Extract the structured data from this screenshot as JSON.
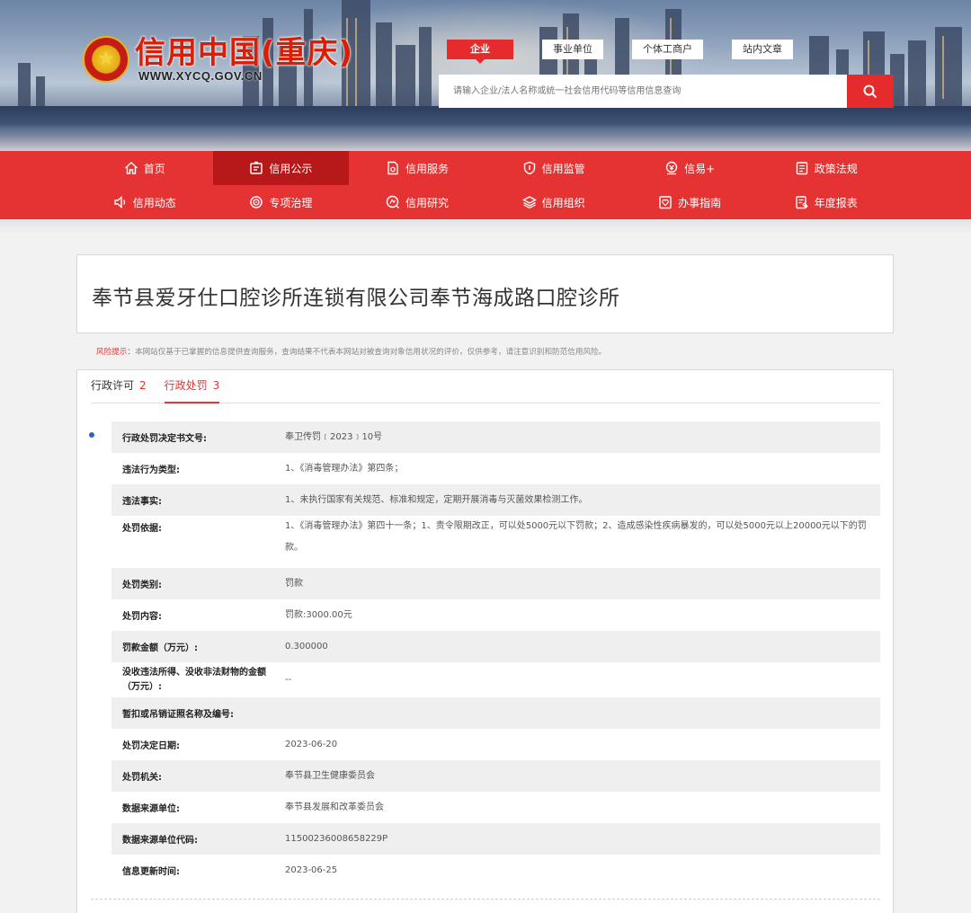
{
  "header": {
    "logo_title": "信用中国(重庆)",
    "logo_url": "WWW.XYCQ.GOV.CN",
    "search_tabs": [
      "企业",
      "事业单位",
      "个体工商户",
      "站内文章"
    ],
    "search_placeholder": "请输入企业/法人名称或统一社会信用代码等信用信息查询"
  },
  "nav": {
    "row1": [
      {
        "label": "首页",
        "icon": "home-icon"
      },
      {
        "label": "信用公示",
        "icon": "notice-icon",
        "active": true
      },
      {
        "label": "信用服务",
        "icon": "document-icon"
      },
      {
        "label": "信用监管",
        "icon": "shield-icon"
      },
      {
        "label": "信易+",
        "icon": "coin-icon"
      },
      {
        "label": "政策法规",
        "icon": "law-icon"
      }
    ],
    "row2": [
      {
        "label": "信用动态",
        "icon": "speaker-icon"
      },
      {
        "label": "专项治理",
        "icon": "target-icon"
      },
      {
        "label": "信用研究",
        "icon": "research-icon"
      },
      {
        "label": "信用组织",
        "icon": "layers-icon"
      },
      {
        "label": "办事指南",
        "icon": "guide-icon"
      },
      {
        "label": "年度报表",
        "icon": "report-icon"
      }
    ]
  },
  "company_name": "奉节县爱牙仕口腔诊所连锁有限公司奉节海成路口腔诊所",
  "risk": {
    "label": "风险提示：",
    "text": "本网站仅基于已掌握的信息提供查询服务，查询结果不代表本网站对被查询对象信用状况的评价，仅供参考，请注意识别和防范信用风险。"
  },
  "tabs": [
    {
      "label": "行政许可",
      "count": "2"
    },
    {
      "label": "行政处罚",
      "count": "3",
      "active": true
    }
  ],
  "details": [
    {
      "key": "行政处罚决定书文号:",
      "value": "奉卫传罚﹝2023﹞10号"
    },
    {
      "key": "违法行为类型:",
      "value": "1、《消毒管理办法》第四条；"
    },
    {
      "key": "违法事实:",
      "value": "1、未执行国家有关规范、标准和规定，定期开展消毒与灭菌效果检测工作。"
    },
    {
      "key": "处罚依据:",
      "value": "1、《消毒管理办法》第四十一条；1、责令限期改正，可以处5000元以下罚款；2、造成感染性疾病暴发的，可以处5000元以上20000元以下的罚款。"
    },
    {
      "key": "处罚类别:",
      "value": "罚款"
    },
    {
      "key": "处罚内容:",
      "value": "罚款:3000.00元"
    },
    {
      "key": "罚款金额（万元）:",
      "value": "0.300000"
    },
    {
      "key": "没收违法所得、没收非法财物的金额（万元）:",
      "value": "--"
    },
    {
      "key": "暂扣或吊销证照名称及编号:",
      "value": ""
    },
    {
      "key": "处罚决定日期:",
      "value": "2023-06-20"
    },
    {
      "key": "处罚机关:",
      "value": "奉节县卫生健康委员会"
    },
    {
      "key": "数据来源单位:",
      "value": "奉节县发展和改革委员会"
    },
    {
      "key": "数据来源单位代码:",
      "value": "11500236008658229P"
    },
    {
      "key": "信息更新时间:",
      "value": "2023-06-25"
    }
  ]
}
